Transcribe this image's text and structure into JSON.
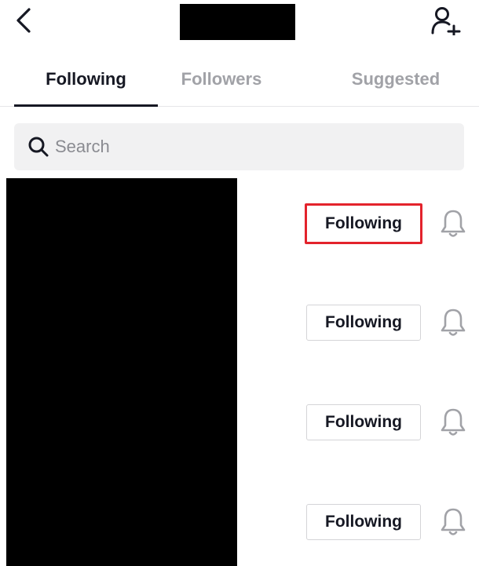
{
  "header": {
    "back_icon": "chevron-left-icon",
    "add_user_icon": "add-user-icon"
  },
  "tabs": [
    {
      "label": "Following",
      "active": true
    },
    {
      "label": "Followers",
      "active": false
    },
    {
      "label": "Suggested",
      "active": false
    }
  ],
  "search": {
    "placeholder": "Search",
    "value": "",
    "icon": "search-icon"
  },
  "rows": [
    {
      "button_label": "Following",
      "bell_icon": "bell-icon",
      "highlighted": true
    },
    {
      "button_label": "Following",
      "bell_icon": "bell-icon",
      "highlighted": false
    },
    {
      "button_label": "Following",
      "bell_icon": "bell-icon",
      "highlighted": false
    },
    {
      "button_label": "Following",
      "bell_icon": "bell-icon",
      "highlighted": false
    }
  ],
  "colors": {
    "highlight": "#e3232c",
    "text": "#161823",
    "inactive_tab": "#a1a2a7",
    "search_bg": "#f1f1f2"
  }
}
